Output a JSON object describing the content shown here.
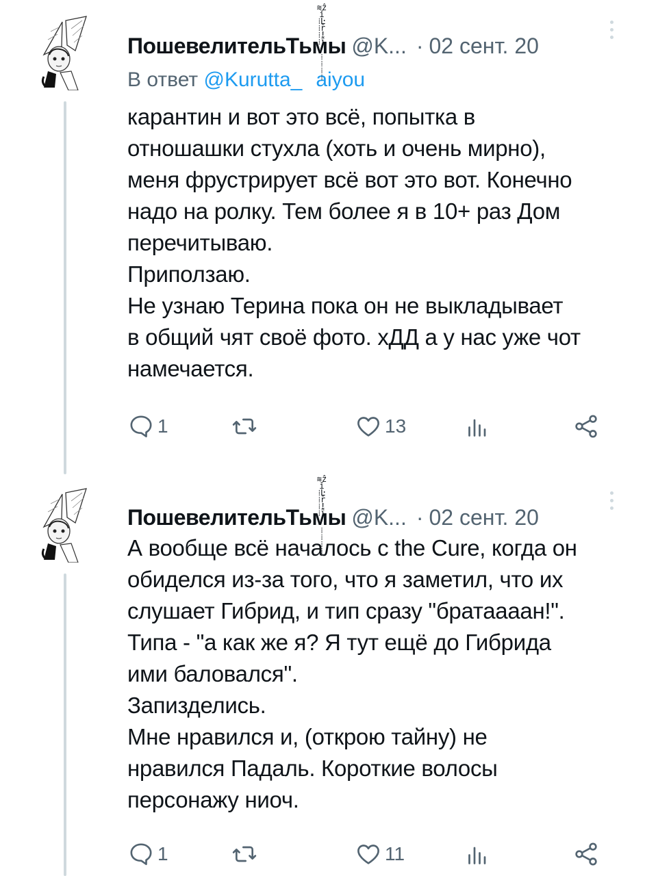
{
  "tweets": [
    {
      "display_name": "Пошевелитель Тьмы",
      "name_start": "Пошевелитель",
      "name_end": "Тьмы",
      "handle": "@K...",
      "dot": "·",
      "date": "02 сент. 20",
      "reply_prefix": "В ответ",
      "reply_handle": "@Kurutta_Taiyou",
      "reply_handle_start": "@Kurutta_",
      "reply_handle_end": "aiyou",
      "body": [
        "карантин и вот это всё, попытка в",
        "отношашки стухла (хоть и очень мирно),",
        "меня фрустрирует всё вот это вот. Конечно",
        "надо на ролку. Тем более я в 10+ раз Дом",
        "перечитываю.",
        "Приползаю.",
        "Не узнаю Терина пока он не выкладывает",
        "в общий чят своё фото. хДД а у нас уже чот",
        "намечается."
      ],
      "reply_count": "1",
      "retweet_count": "",
      "like_count": "13",
      "views_count": ""
    },
    {
      "display_name": "Пошевелитель Тьмы",
      "name_start": "Пошевелитель",
      "name_end": "Тьмы",
      "handle": "@K...",
      "dot": "·",
      "date": "02 сент. 20",
      "body": [
        "А вообще всё началось с the Cure, когда он",
        "обиделся из-за того, что я заметил, что их",
        "слушает Гибрид, и тип сразу \"братаааан!\".",
        "Типа - \"а как же я? Я тут ещё до Гибрида",
        "ими баловался\".",
        "Запизделись.",
        "Мне нравился и, (открою тайну) не",
        "нравился Падаль. Короткие волосы",
        "персонажу ниоч."
      ],
      "reply_count": "1",
      "retweet_count": "",
      "like_count": "11",
      "views_count": ""
    }
  ],
  "icons": {
    "reply": "comment-icon",
    "retweet": "retweet-icon",
    "like": "heart-icon",
    "views": "views-bar-chart-icon",
    "share": "share-icon",
    "more": "more-vertical-icon"
  },
  "colors": {
    "text": "#0f1419",
    "secondary": "#536471",
    "link": "#1d9bf0",
    "thread_line": "#cfd9de"
  }
}
